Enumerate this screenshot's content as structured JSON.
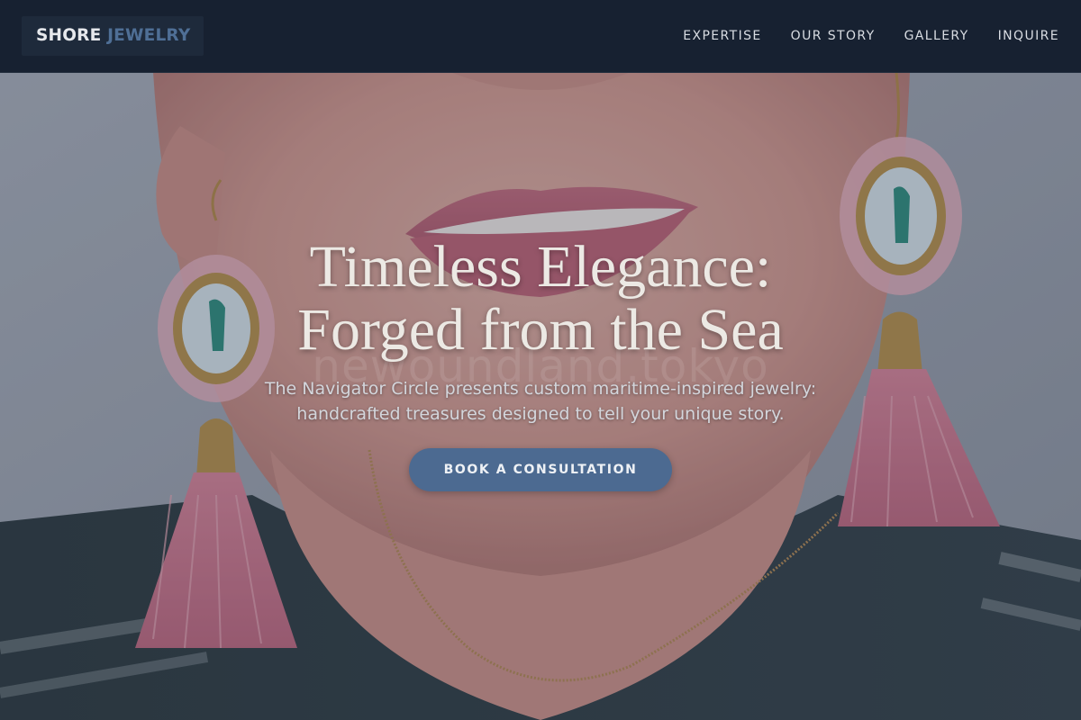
{
  "brand": {
    "name_primary": "SHORE",
    "name_accent": "JEWELRY"
  },
  "nav": {
    "links": [
      {
        "label": "EXPERTISE"
      },
      {
        "label": "OUR STORY"
      },
      {
        "label": "GALLERY"
      },
      {
        "label": "INQUIRE"
      }
    ]
  },
  "hero": {
    "title_line1": "Timeless Elegance:",
    "title_line2": "Forged from the Sea",
    "subtitle_line1": "The Navigator Circle presents custom maritime-inspired jewelry:",
    "subtitle_line2": "handcrafted treasures designed to tell your unique story.",
    "cta_label": "BOOK A CONSULTATION",
    "watermark": "newoundland.tokyo",
    "background_image": "portrait-with-tassel-earrings"
  },
  "colors": {
    "nav_background": "#172131",
    "logo_accent": "#4f6f96",
    "cta_background": "#4c6a91",
    "title_text": "#ece9e4",
    "tassel_pink": "#c9768c"
  }
}
